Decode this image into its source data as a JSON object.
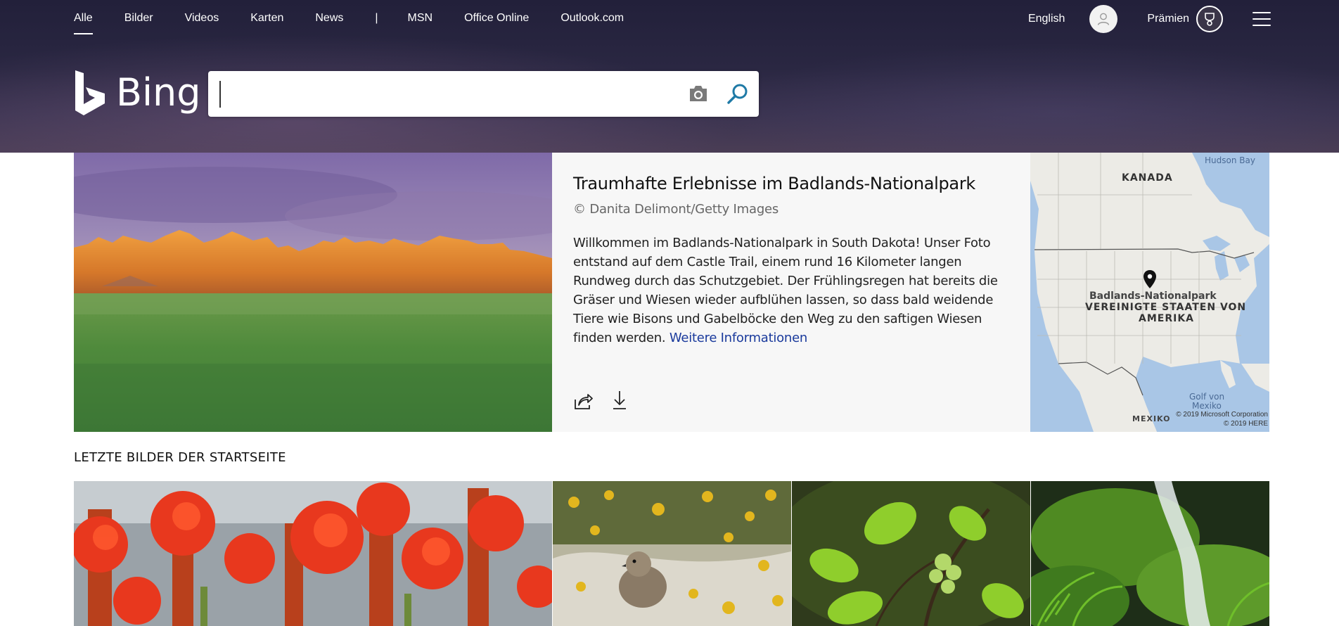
{
  "nav": {
    "items": [
      "Alle",
      "Bilder",
      "Videos",
      "Karten",
      "News"
    ],
    "separator": "|",
    "items_right": [
      "MSN",
      "Office Online",
      "Outlook.com"
    ]
  },
  "header": {
    "language_link": "English",
    "rewards_label": "Prämien",
    "avatar_icon": "user-icon",
    "rewards_icon": "trophy-icon",
    "menu_icon": "hamburger-menu-icon"
  },
  "logo": {
    "text": "Bing"
  },
  "search": {
    "value": "",
    "placeholder": "",
    "camera_icon": "camera-icon",
    "search_icon": "magnifier-icon",
    "accent": "#1f7aa6"
  },
  "hero": {
    "title": "Traumhafte Erlebnisse im Badlands-Nationalpark",
    "credit": "© Danita Delimont/Getty Images",
    "description": "Willkommen im Badlands-Nationalpark in South Dakota! Unser Foto entstand auf dem Castle Trail, einem rund 16 Kilometer langen Rundweg durch das Schutzgebiet. Der Frühlingsregen hat bereits die Gräser und Wiesen wieder aufblühen lassen, so dass bald weidende Tiere wie Bisons und Gabelböcke den Weg zu den saftigen Wiesen finden werden.",
    "more_link": "Weitere Informationen",
    "link_color": "#1a3a9c",
    "share_icon": "share-icon",
    "download_icon": "download-icon"
  },
  "map": {
    "labels": {
      "hudson_bay": "Hudson Bay",
      "canada": "KANADA",
      "park": "Badlands-Nationalpark",
      "usa_line1": "VEREINIGTE STAATEN VON",
      "usa_line2": "AMERIKA",
      "gulf_line1": "Golf von",
      "gulf_line2": "Mexiko",
      "mexico": "MEXIKO"
    },
    "copyright_1": "© 2019 Microsoft Corporation",
    "copyright_2": "© 2019 HERE",
    "pin_icon": "map-pin-icon"
  },
  "recent": {
    "title": "LETZTE BILDER DER STARTSEITE",
    "images": [
      "red-aloe-flowers",
      "bird-chick-in-sand-flowers",
      "green-leaves-and-seeds",
      "mossy-waterfall-with-ferns"
    ]
  }
}
